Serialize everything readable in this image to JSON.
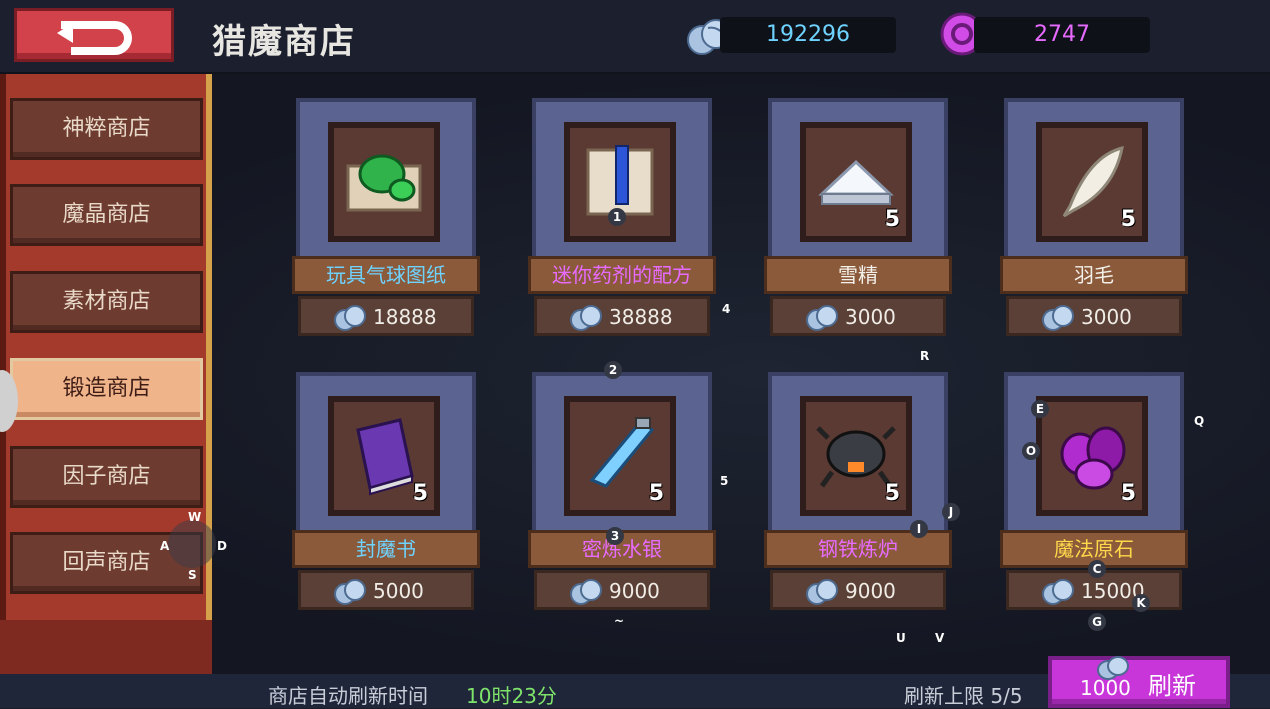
{
  "header": {
    "title": "猎魔商店",
    "gems": "192296",
    "crystals": "2747",
    "gems_icon": "gem-pile-icon",
    "crystal_icon": "purple-orb-icon"
  },
  "tabs": [
    {
      "label": "神粹商店",
      "active": false
    },
    {
      "label": "魔晶商店",
      "active": false
    },
    {
      "label": "素材商店",
      "active": false
    },
    {
      "label": "锻造商店",
      "active": true
    },
    {
      "label": "因子商店",
      "active": false
    },
    {
      "label": "回声商店",
      "active": false
    }
  ],
  "items": [
    {
      "name": "玩具气球图纸",
      "price": "18888",
      "qty": "",
      "name_color": "#6fd3ff",
      "icon": "green-blueprint-scroll-icon"
    },
    {
      "name": "迷你药剂的配方",
      "price": "38888",
      "qty": "",
      "name_color": "#e86bff",
      "icon": "potion-recipe-scroll-icon"
    },
    {
      "name": "雪精",
      "price": "3000",
      "qty": "5",
      "name_color": "#f4f0ea",
      "icon": "snow-essence-icon"
    },
    {
      "name": "羽毛",
      "price": "3000",
      "qty": "5",
      "name_color": "#f4f0ea",
      "icon": "feather-icon"
    },
    {
      "name": "封魔书",
      "price": "5000",
      "qty": "5",
      "name_color": "#6fd3ff",
      "icon": "purple-book-icon"
    },
    {
      "name": "密炼水银",
      "price": "9000",
      "qty": "5",
      "name_color": "#e86bff",
      "icon": "mercury-vial-icon"
    },
    {
      "name": "钢铁炼炉",
      "price": "9000",
      "qty": "5",
      "name_color": "#e86bff",
      "icon": "iron-furnace-icon"
    },
    {
      "name": "魔法原石",
      "price": "15000",
      "qty": "5",
      "name_color": "#ffd84a",
      "icon": "magic-ore-icon"
    }
  ],
  "footer": {
    "refresh_time_label": "商店自动刷新时间",
    "refresh_time_value": "10时23分",
    "refresh_limit": "刷新上限 5/5",
    "refresh_button": "刷新",
    "refresh_cost": "1000"
  },
  "overlay_keys": [
    "1",
    "2",
    "3",
    "4",
    "5",
    "5",
    "R",
    "E",
    "O",
    "Q",
    "I",
    "J",
    "C",
    "K",
    "G",
    "U",
    "V",
    "W",
    "A",
    "D",
    "S",
    "~"
  ]
}
